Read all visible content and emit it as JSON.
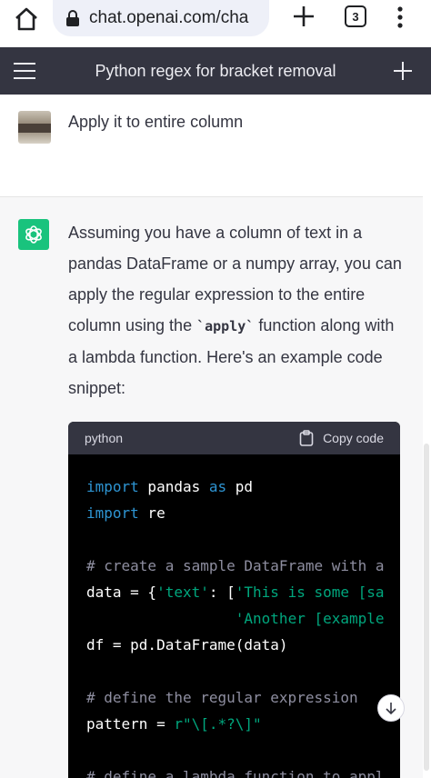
{
  "browser": {
    "url": "chat.openai.com/cha",
    "tab_count": "3"
  },
  "header": {
    "title": "Python regex for bracket removal"
  },
  "user_message": {
    "text": "Apply it to entire column"
  },
  "assistant_message": {
    "text_before": "Assuming you have a column of text in a pandas DataFrame or a numpy array, you can apply the regular expression to the entire column using the ",
    "inline_code": "`apply`",
    "text_after": " function along with a lambda function. Here's an example code snippet:"
  },
  "code_block": {
    "language": "python",
    "copy_label": "Copy code",
    "lines": {
      "l1_kw1": "import",
      "l1_rest": " pandas ",
      "l1_kw2": "as",
      "l1_end": " pd",
      "l2_kw": "import",
      "l2_rest": " re",
      "l3_comment": "# create a sample DataFrame with a",
      "l4_pre": "data = {",
      "l4_key": "'text'",
      "l4_mid": ": [",
      "l4_str": "'This is some [sa",
      "l5_pad": "                 ",
      "l5_str": "'Another [example",
      "l6": "df = pd.DataFrame(data)",
      "l7_comment": "# define the regular expression",
      "l8_pre": "pattern = ",
      "l8_str": "r\"\\[.*?\\]\"",
      "l9_comment": "# define a lambda function to appl"
    }
  },
  "colors": {
    "header_bg": "#343541",
    "assistant_bg": "#f7f7f8",
    "gpt_green": "#19c37d",
    "code_bg": "#000000",
    "keyword": "#2e95d3",
    "string": "#00a67d",
    "comment": "#8e8ea0"
  }
}
